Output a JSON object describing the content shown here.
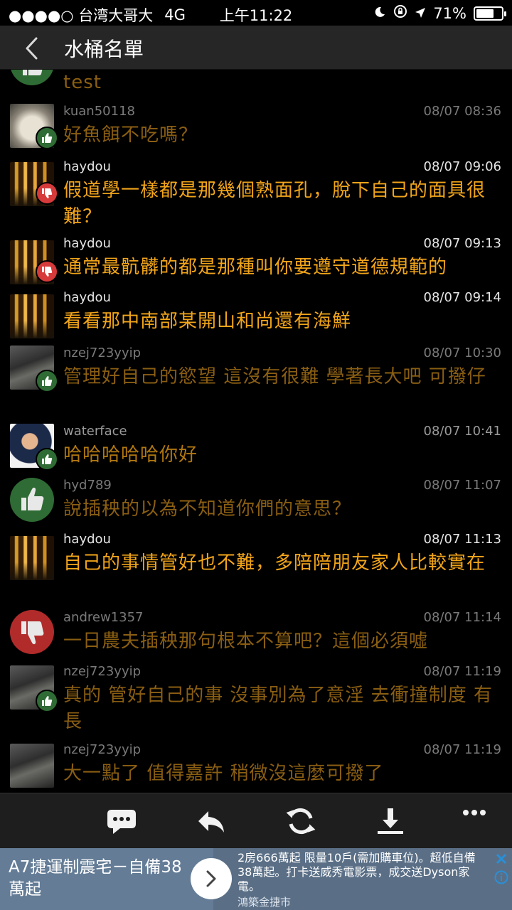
{
  "status_bar": {
    "carrier": "●●●●○ 台湾大哥大",
    "network": "4G",
    "time": "上午11:22",
    "battery_text": "71%",
    "battery_level": 0.71
  },
  "nav": {
    "title": "水桶名單"
  },
  "messages": [
    {
      "user": "",
      "time": "",
      "text": "test"
    },
    {
      "user": "kuan50118",
      "time": "08/07 08:36",
      "text": "好魚餌不吃嗎？"
    },
    {
      "user": "haydou",
      "time": "08/07 09:06",
      "text": "假道學一樣都是那幾個熟面孔，脫下自己的面具很難？"
    },
    {
      "user": "haydou",
      "time": "08/07 09:13",
      "text": "通常最骯髒的都是那種叫你要遵守道德規範的"
    },
    {
      "user": "haydou",
      "time": "08/07 09:14",
      "text": "看看那中南部某開山和尚還有海鮮"
    },
    {
      "user": "nzej723yyip",
      "time": "08/07 10:30",
      "text": "管理好自己的慾望 這沒有很難 學著長大吧 可撥仔"
    },
    {
      "user": "waterface",
      "time": "08/07 10:41",
      "text": "哈哈哈哈哈你好"
    },
    {
      "user": "hyd789",
      "time": "08/07 11:07",
      "text": "說插秧的以為不知道你們的意思？"
    },
    {
      "user": "haydou",
      "time": "08/07 11:13",
      "text": "自己的事情管好也不難，多陪陪朋友家人比較實在"
    },
    {
      "user": "andrew1357",
      "time": "08/07 11:14",
      "text": "一日農夫插秧那句根本不算吧？這個必須噓"
    },
    {
      "user": "nzej723yyip",
      "time": "08/07 11:19",
      "text": "真的 管好自己的事 沒事別為了意淫 去衝撞制度 有長"
    },
    {
      "user": "nzej723yyip",
      "time": "08/07 11:19",
      "text": "大一點了 值得嘉許 稍微沒這麼可撥了"
    }
  ],
  "toolbar": {
    "icons": [
      "comment-icon",
      "reply-icon",
      "refresh-icon",
      "download-icon",
      "more-icon"
    ]
  },
  "ad": {
    "headline": "A7捷運制震宅－自備38萬起",
    "body": "2房666萬起 限量10戶(需加購車位)。超低自備38萬起。打卡送威秀電影票，成交送Dyson家電。",
    "advertiser": "鴻築金捷市"
  }
}
